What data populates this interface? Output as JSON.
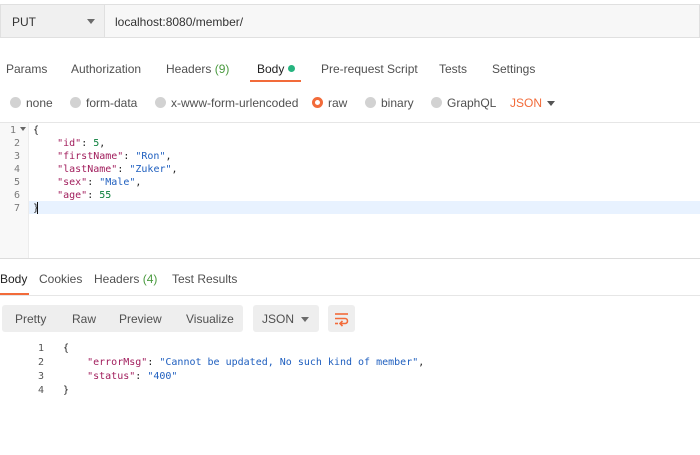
{
  "request": {
    "method": "PUT",
    "url": "localhost:8080/member/"
  },
  "request_tabs": [
    {
      "label": "Params"
    },
    {
      "label": "Authorization"
    },
    {
      "label": "Headers",
      "count": "(9)"
    },
    {
      "label": "Body"
    },
    {
      "label": "Pre-request Script"
    },
    {
      "label": "Tests"
    },
    {
      "label": "Settings"
    }
  ],
  "body_options": {
    "none": "none",
    "form_data": "form-data",
    "urlencoded": "x-www-form-urlencoded",
    "raw": "raw",
    "binary": "binary",
    "graphql": "GraphQL",
    "format": "JSON",
    "selected": "raw"
  },
  "request_body": {
    "line_numbers": [
      "1",
      "2",
      "3",
      "4",
      "5",
      "6",
      "7"
    ],
    "open_brace": "{",
    "close_brace": "}",
    "fields": [
      {
        "key": "\"id\"",
        "value": "5",
        "type": "number",
        "trail": ","
      },
      {
        "key": "\"firstName\"",
        "value": "\"Ron\"",
        "type": "string",
        "trail": ","
      },
      {
        "key": "\"lastName\"",
        "value": "\"Zuker\"",
        "type": "string",
        "trail": ","
      },
      {
        "key": "\"sex\"",
        "value": "\"Male\"",
        "type": "string",
        "trail": ","
      },
      {
        "key": "\"age\"",
        "value": "55",
        "type": "number",
        "trail": ""
      }
    ]
  },
  "response_tabs": [
    {
      "label": "Body"
    },
    {
      "label": "Cookies"
    },
    {
      "label": "Headers",
      "count": "(4)"
    },
    {
      "label": "Test Results"
    }
  ],
  "response_toolbar": {
    "views": [
      "Pretty",
      "Raw",
      "Preview",
      "Visualize"
    ],
    "format": "JSON",
    "wrap_icon": "wrap-lines-icon"
  },
  "response_body": {
    "line_numbers": [
      "1",
      "2",
      "3",
      "4"
    ],
    "open_brace": "{",
    "close_brace": "}",
    "fields": [
      {
        "key": "\"errorMsg\"",
        "value": "\"Cannot be updated, No such kind of member\"",
        "trail": ","
      },
      {
        "key": "\"status\"",
        "value": "\"400\"",
        "trail": ""
      }
    ]
  },
  "colors": {
    "accent": "#f26b3a",
    "body_dot": "#26b47f",
    "count": "#4a9a3f",
    "json_key": "#a11d5c",
    "json_string": "#1f5fbf",
    "json_number": "#0a7e3a"
  }
}
